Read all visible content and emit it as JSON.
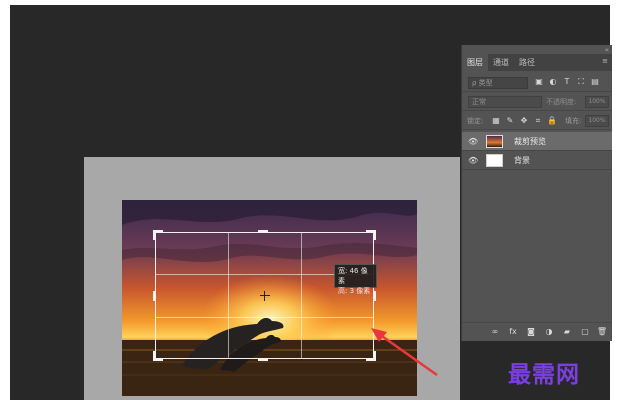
{
  "panel": {
    "collapse_glyph": "«",
    "menu_glyph": "≡",
    "tabs": [
      {
        "label": "图层",
        "active": true
      },
      {
        "label": "通道",
        "active": false
      },
      {
        "label": "路径",
        "active": false
      }
    ],
    "filter": {
      "placeholder": "ρ 类型",
      "icons": [
        {
          "name": "image-filter-icon",
          "glyph": "▣"
        },
        {
          "name": "adjustment-filter-icon",
          "glyph": "◐"
        },
        {
          "name": "type-filter-icon",
          "glyph": "T"
        },
        {
          "name": "shape-filter-icon",
          "glyph": "⛶"
        },
        {
          "name": "smart-object-filter-icon",
          "glyph": "▤"
        }
      ]
    },
    "blend": {
      "mode": "正常",
      "opacity_label": "不透明度:",
      "opacity_value": "100%"
    },
    "lock": {
      "label": "锁定:",
      "icons": [
        {
          "name": "lock-transparent-icon",
          "glyph": "▦"
        },
        {
          "name": "lock-brush-icon",
          "glyph": "✎"
        },
        {
          "name": "lock-move-icon",
          "glyph": "✥"
        },
        {
          "name": "lock-artboard-icon",
          "glyph": "⌗"
        },
        {
          "name": "lock-all-icon",
          "glyph": "🔒"
        }
      ],
      "fill_label": "填充:",
      "fill_value": "100%"
    },
    "layers": [
      {
        "name": "裁剪预览",
        "selected": true,
        "eye": "👁"
      },
      {
        "name": "背景",
        "selected": false,
        "eye": "👁"
      }
    ],
    "bottom_icons": [
      {
        "name": "link-layers-icon",
        "glyph": "∞"
      },
      {
        "name": "fx-icon",
        "glyph": "fx"
      },
      {
        "name": "mask-icon",
        "glyph": "◙"
      },
      {
        "name": "adjustment-layer-icon",
        "glyph": "◑"
      },
      {
        "name": "group-folder-icon",
        "glyph": "▰"
      },
      {
        "name": "new-layer-icon",
        "glyph": "▢"
      },
      {
        "name": "trash-icon",
        "glyph": "🗑"
      }
    ]
  },
  "tooltip": {
    "line1": "宽: 46 像素",
    "line2": "高: 3 像素"
  },
  "watermark": "最需网",
  "colors": {
    "workspace": "#282828",
    "canvas_board": "#a8a8a8",
    "panel": "#535353",
    "arrow": "#e8383d",
    "watermark": "#7b3fe0"
  }
}
